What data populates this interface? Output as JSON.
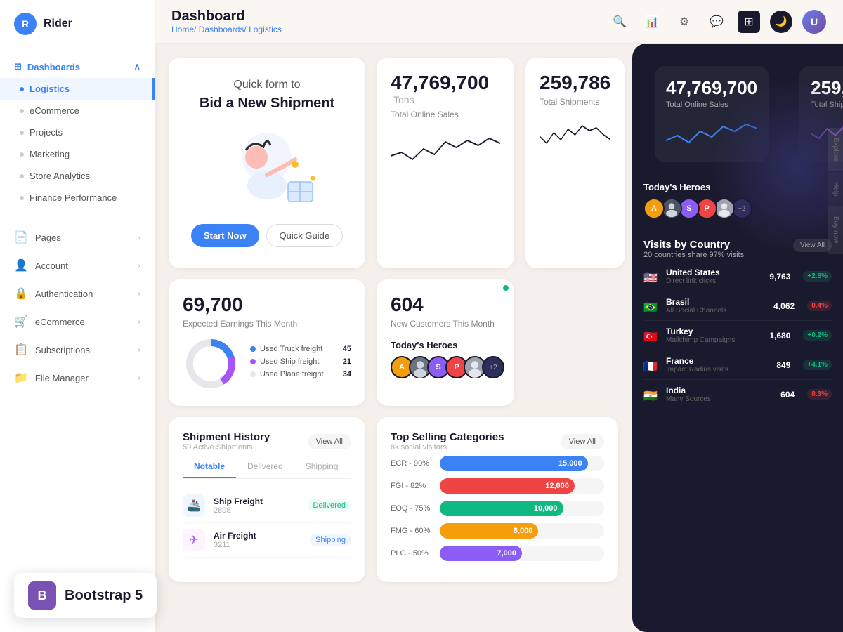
{
  "app": {
    "name": "Rider",
    "logo_letter": "R"
  },
  "topbar": {
    "page_title": "Dashboard",
    "breadcrumb_home": "Home/",
    "breadcrumb_dashboards": "Dashboards/",
    "breadcrumb_current": "Logistics"
  },
  "sidebar": {
    "dashboards_label": "Dashboards",
    "items": [
      {
        "label": "Logistics",
        "active": true
      },
      {
        "label": "eCommerce",
        "active": false
      },
      {
        "label": "Projects",
        "active": false
      },
      {
        "label": "Marketing",
        "active": false
      },
      {
        "label": "Store Analytics",
        "active": false
      },
      {
        "label": "Finance Performance",
        "active": false
      }
    ],
    "main_items": [
      {
        "label": "Pages",
        "icon": "📄"
      },
      {
        "label": "Account",
        "icon": "👤"
      },
      {
        "label": "Authentication",
        "icon": "🔒"
      },
      {
        "label": "eCommerce",
        "icon": "🛒"
      },
      {
        "label": "Subscriptions",
        "icon": "📋"
      },
      {
        "label": "File Manager",
        "icon": "📁"
      }
    ]
  },
  "hero_card": {
    "title": "Quick form to",
    "subtitle": "Bid a New Shipment",
    "btn_primary": "Start Now",
    "btn_secondary": "Quick Guide"
  },
  "stat_cards": [
    {
      "value": "47,769,700",
      "unit": "Tons",
      "label": "Total Online Sales"
    },
    {
      "value": "259,786",
      "unit": "",
      "label": "Total Shipments"
    },
    {
      "value": "69,700",
      "unit": "",
      "label": "Expected Earnings This Month"
    },
    {
      "value": "604",
      "unit": "",
      "label": "New Customers This Month"
    }
  ],
  "donut": {
    "segments": [
      {
        "label": "Used Truck freight",
        "pct": 45,
        "color": "#3b82f6"
      },
      {
        "label": "Used Ship freight",
        "pct": 21,
        "color": "#a855f7"
      },
      {
        "label": "Used Plane freight",
        "pct": 34,
        "color": "#e5e7eb"
      }
    ]
  },
  "heroes": {
    "title": "Today's Heroes",
    "avatars": [
      {
        "color": "#f59e0b",
        "letter": "A"
      },
      {
        "color": "#3b82f6",
        "letter": "S"
      },
      {
        "color": "#8b5cf6",
        "letter": "S"
      },
      {
        "color": "#ef4444",
        "letter": "P"
      },
      {
        "color": "#10b981",
        "letter": ""
      },
      {
        "count": "+2"
      }
    ]
  },
  "shipment_history": {
    "title": "Shipment History",
    "subtitle": "59 Active Shipments",
    "view_all": "View All",
    "tabs": [
      "Notable",
      "Delivered",
      "Shipping"
    ],
    "items": [
      {
        "name": "Ship Freight",
        "id": "2808",
        "status": "Delivered",
        "status_type": "delivered"
      },
      {
        "name": "Air Freight",
        "id": "3211",
        "status": "Shipping",
        "status_type": "shipping"
      }
    ]
  },
  "top_selling": {
    "title": "Top Selling Categories",
    "subtitle": "8k social visitors",
    "view_all": "View All",
    "bars": [
      {
        "label": "ECR - 90%",
        "value": 15000,
        "display": "15,000",
        "color": "#3b82f6",
        "pct": 90
      },
      {
        "label": "FGI - 82%",
        "value": 12000,
        "display": "12,000",
        "color": "#ef4444",
        "pct": 82
      },
      {
        "label": "EOQ - 75%",
        "value": 10000,
        "display": "10,000",
        "color": "#10b981",
        "pct": 75
      },
      {
        "label": "FMG - 60%",
        "value": 8000,
        "display": "8,000",
        "color": "#f59e0b",
        "pct": 60
      },
      {
        "label": "PLG - 50%",
        "value": 7000,
        "display": "7,000",
        "color": "#8b5cf6",
        "pct": 50
      }
    ]
  },
  "visits_by_country": {
    "title": "Visits by Country",
    "subtitle": "20 countries share 97% visits",
    "view_all": "View All",
    "countries": [
      {
        "flag": "🇺🇸",
        "name": "United States",
        "source": "Direct link clicks",
        "visits": "9,763",
        "change": "+2.6%",
        "up": true
      },
      {
        "flag": "🇧🇷",
        "name": "Brasil",
        "source": "All Social Channels",
        "visits": "4,062",
        "change": "0.4%",
        "up": false
      },
      {
        "flag": "🇹🇷",
        "name": "Turkey",
        "source": "Mailchimp Campaigns",
        "visits": "1,680",
        "change": "+0.2%",
        "up": true
      },
      {
        "flag": "🇫🇷",
        "name": "France",
        "source": "Impact Radius visits",
        "visits": "849",
        "change": "+4.1%",
        "up": true
      },
      {
        "flag": "🇮🇳",
        "name": "India",
        "source": "Many Sources",
        "visits": "604",
        "change": "8.3%",
        "up": false
      }
    ]
  },
  "vertical_tabs": [
    "Explore",
    "Help",
    "Buy now"
  ]
}
